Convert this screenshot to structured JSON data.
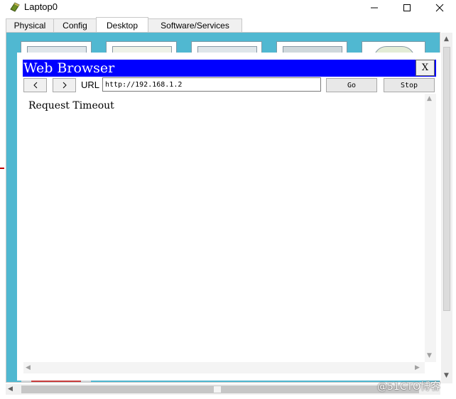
{
  "window": {
    "title": "Laptop0",
    "controls": {
      "minimize_icon": "minimize-icon",
      "maximize_icon": "maximize-icon",
      "close_icon": "close-icon"
    }
  },
  "tabs": [
    {
      "label": "Physical",
      "active": false
    },
    {
      "label": "Config",
      "active": false
    },
    {
      "label": "Desktop",
      "active": true
    },
    {
      "label": "Software/Services",
      "active": false
    }
  ],
  "desktop": {
    "background_color": "#50b8d1"
  },
  "browser": {
    "title": "Web Browser",
    "close_label": "X",
    "title_bar_color": "#0000ff",
    "back_label": "<",
    "forward_label": ">",
    "url_label": "URL",
    "url_value": "http://192.168.1.2",
    "go_label": "Go",
    "stop_label": "Stop",
    "page_message": "Request Timeout"
  },
  "watermark": "@51CTO博客"
}
